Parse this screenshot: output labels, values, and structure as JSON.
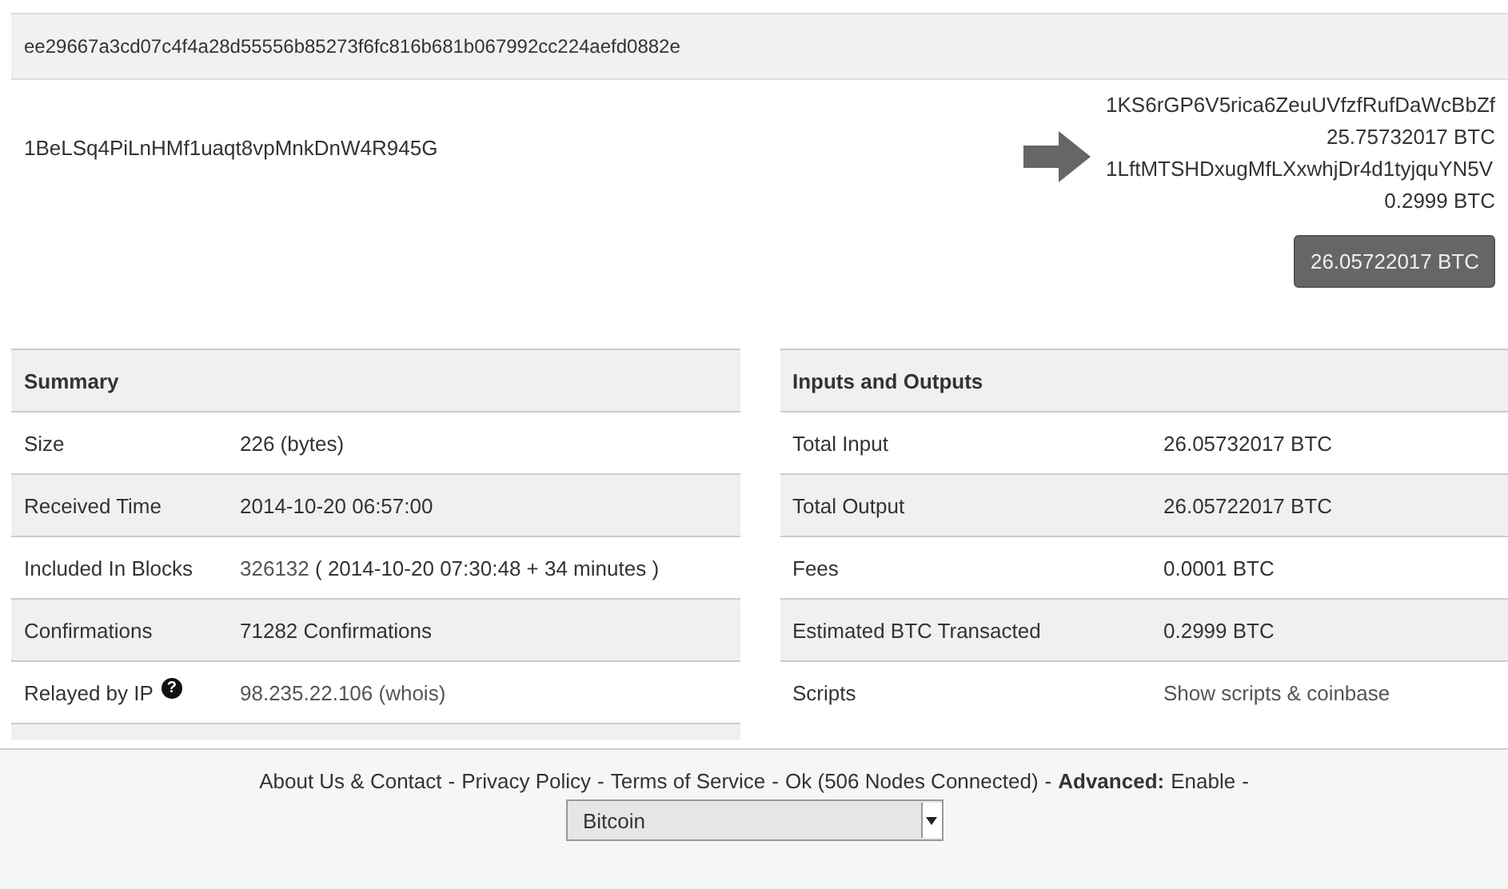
{
  "transaction_hash": "ee29667a3cd07c4f4a28d55556b85273f6fc816b681b067992cc224aefd0882e",
  "inputs": [
    {
      "address": "1BeLSq4PiLnHMf1uaqt8vpMnkDnW4R945G"
    }
  ],
  "outputs": [
    {
      "address": "1KS6rGP6V5rica6ZeuUVfzfRufDaWcBbZf",
      "amount": "25.75732017 BTC"
    },
    {
      "address": "1LftMTSHDxugMfLXxwhjDr4d1tyjquYN5V",
      "amount": "0.2999 BTC"
    }
  ],
  "total_button": "26.05722017 BTC",
  "tables": [
    {
      "title": "Summary",
      "rows": [
        {
          "label": "Size",
          "value": [
            {
              "kind": "text",
              "text": "226 (bytes)"
            }
          ]
        },
        {
          "label": "Received Time",
          "value": [
            {
              "kind": "text",
              "text": "2014-10-20 06:57:00"
            }
          ]
        },
        {
          "label": "Included In Blocks",
          "value": [
            {
              "kind": "link",
              "text": "326132"
            },
            {
              "kind": "text",
              "text": "( 2014-10-20 07:30:48 + 34 minutes )"
            }
          ]
        },
        {
          "label": "Confirmations",
          "value": [
            {
              "kind": "text",
              "text": "71282 Confirmations"
            }
          ]
        },
        {
          "label": "Relayed by IP",
          "badge": "?",
          "value": [
            {
              "kind": "link",
              "text": "98.235.22.106 (whois)"
            }
          ]
        }
      ]
    },
    {
      "title": "Inputs and Outputs",
      "rows": [
        {
          "label": "Total Input",
          "value": [
            {
              "kind": "text",
              "text": "26.05732017 BTC"
            }
          ]
        },
        {
          "label": "Total Output",
          "value": [
            {
              "kind": "text",
              "text": "26.05722017 BTC"
            }
          ]
        },
        {
          "label": "Fees",
          "value": [
            {
              "kind": "text",
              "text": "0.0001 BTC"
            }
          ]
        },
        {
          "label": "Estimated BTC Transacted",
          "value": [
            {
              "kind": "text",
              "text": "0.2999 BTC"
            }
          ]
        },
        {
          "label": "Scripts",
          "value": [
            {
              "kind": "link",
              "text": "Show scripts & coinbase"
            }
          ]
        }
      ]
    }
  ],
  "footer": {
    "items": [
      {
        "kind": "link",
        "text": "About Us & Contact"
      },
      {
        "kind": "separator",
        "text": "-"
      },
      {
        "kind": "link",
        "text": "Privacy Policy"
      },
      {
        "kind": "separator",
        "text": "-"
      },
      {
        "kind": "link",
        "text": "Terms of Service"
      },
      {
        "kind": "separator",
        "text": "-"
      },
      {
        "kind": "link",
        "text": "Ok (506 Nodes Connected)"
      },
      {
        "kind": "separator",
        "text": "-"
      },
      {
        "kind": "label",
        "text": "Advanced:"
      },
      {
        "kind": "link",
        "text": "Enable"
      },
      {
        "kind": "separator",
        "text": "-"
      }
    ],
    "currency_select": "Bitcoin"
  }
}
